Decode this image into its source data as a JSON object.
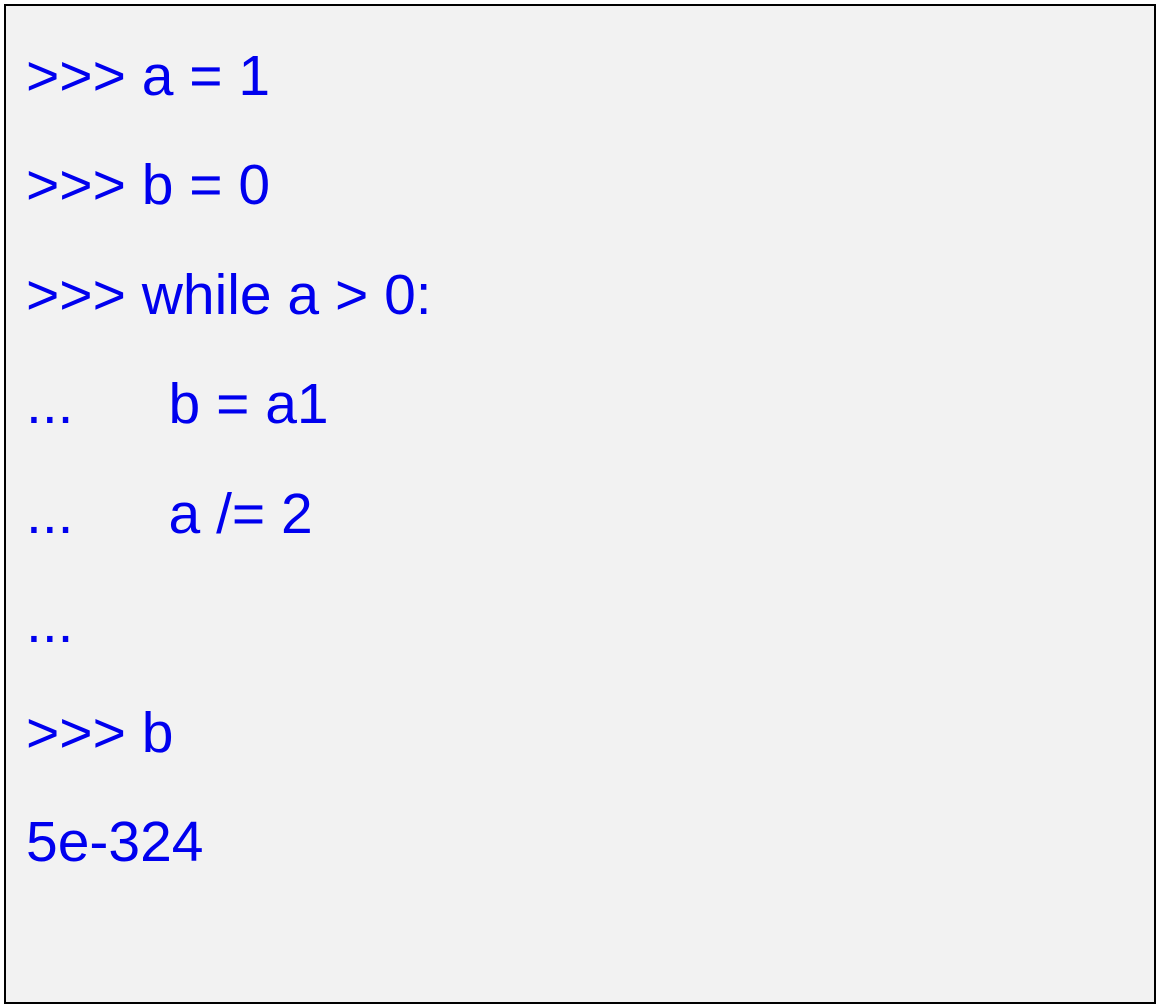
{
  "terminal": {
    "lines": [
      {
        "prompt": ">>> ",
        "code": "a = 1"
      },
      {
        "prompt": ">>> ",
        "code": "b = 0"
      },
      {
        "prompt": ">>> ",
        "code": "while a > 0:"
      },
      {
        "prompt": "...      ",
        "code": "b = a1"
      },
      {
        "prompt": "...      ",
        "code": "a /= 2"
      },
      {
        "prompt": "...",
        "code": ""
      },
      {
        "prompt": ">>> ",
        "code": "b"
      },
      {
        "prompt": "",
        "code": "5e-324"
      }
    ]
  }
}
